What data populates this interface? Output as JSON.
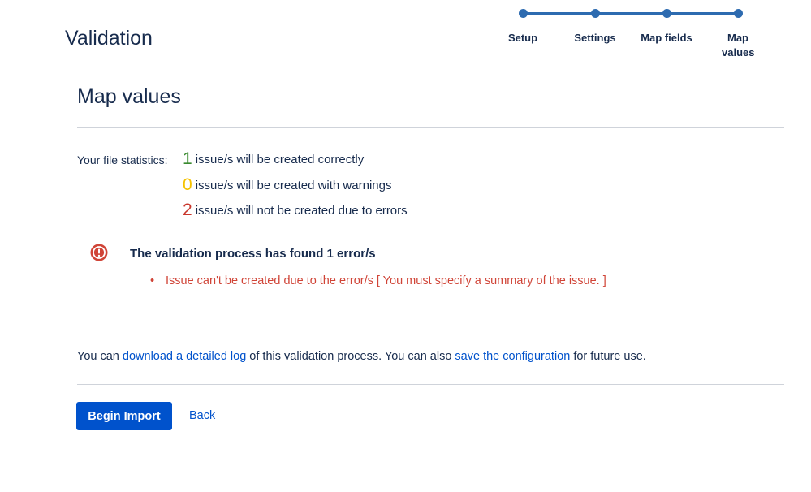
{
  "header": {
    "title": "Validation"
  },
  "progress": {
    "steps": [
      {
        "label": "Setup"
      },
      {
        "label": "Settings"
      },
      {
        "label": "Map fields"
      },
      {
        "label": "Map values"
      }
    ],
    "current_step": 4
  },
  "section": {
    "title": "Map values"
  },
  "stats": {
    "label": "Your file statistics:",
    "rows": [
      {
        "count": "1",
        "text": "issue/s will be created correctly",
        "color": "#3a8a2f"
      },
      {
        "count": "0",
        "text": "issue/s will be created with warnings",
        "color": "#f5c200"
      },
      {
        "count": "2",
        "text": "issue/s will not be created due to errors",
        "color": "#c9372c"
      }
    ]
  },
  "errors": {
    "heading": "The validation process has found 1 error/s",
    "icon": "error-icon",
    "items": [
      "Issue can't be created due to the error/s [ You must specify a summary of the issue. ]"
    ],
    "color": "#d04437"
  },
  "footer": {
    "text_1": "You can ",
    "link_log": "download a detailed log",
    "text_2": " of this validation process. You can also ",
    "link_config": "save the configuration",
    "text_3": " for future use."
  },
  "actions": {
    "primary_label": "Begin Import",
    "back_label": "Back"
  },
  "colors": {
    "accent": "#0052cc",
    "tracker": "#2d6bb0",
    "text": "#172b4d"
  }
}
